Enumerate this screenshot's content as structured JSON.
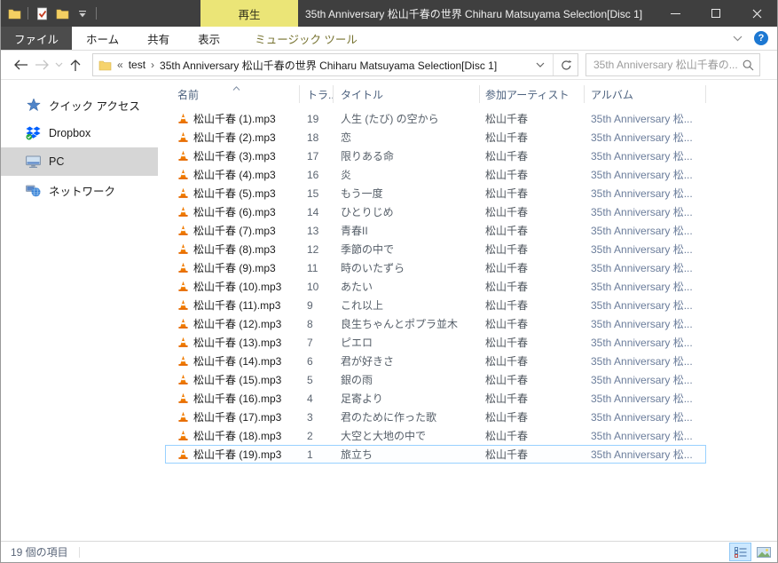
{
  "window": {
    "title": "35th Anniversary 松山千春の世界 Chiharu Matsuyama Selection[Disc 1]",
    "contextual_tab": "再生"
  },
  "ribbon": {
    "tabs": [
      "ファイル",
      "ホーム",
      "共有",
      "表示",
      "ミュージック ツール"
    ]
  },
  "navbar": {
    "breadcrumb_overflow": "«",
    "breadcrumb_separator": "›",
    "segments": [
      "test",
      "35th Anniversary 松山千春の世界 Chiharu Matsuyama Selection[Disc 1]"
    ],
    "search_placeholder": "35th Anniversary 松山千春の..."
  },
  "sidebar": {
    "items": [
      {
        "label": "クイック アクセス",
        "icon": "star-icon"
      },
      {
        "label": "Dropbox",
        "icon": "dropbox-icon"
      },
      {
        "label": "PC",
        "icon": "monitor-icon",
        "selected": true
      },
      {
        "label": "ネットワーク",
        "icon": "network-icon"
      }
    ]
  },
  "filelist": {
    "columns": [
      "名前",
      "トラ...",
      "タイトル",
      "参加アーティスト",
      "アルバム"
    ],
    "sort_column": "名前",
    "sort_direction": "ascending",
    "rows": [
      {
        "name": "松山千春 (1).mp3",
        "track": "19",
        "title": "人生 (たび) の空から",
        "artist": "松山千春",
        "album": "35th Anniversary 松..."
      },
      {
        "name": "松山千春 (2).mp3",
        "track": "18",
        "title": "恋",
        "artist": "松山千春",
        "album": "35th Anniversary 松..."
      },
      {
        "name": "松山千春 (3).mp3",
        "track": "17",
        "title": "限りある命",
        "artist": "松山千春",
        "album": "35th Anniversary 松..."
      },
      {
        "name": "松山千春 (4).mp3",
        "track": "16",
        "title": "炎",
        "artist": "松山千春",
        "album": "35th Anniversary 松..."
      },
      {
        "name": "松山千春 (5).mp3",
        "track": "15",
        "title": "もう一度",
        "artist": "松山千春",
        "album": "35th Anniversary 松..."
      },
      {
        "name": "松山千春 (6).mp3",
        "track": "14",
        "title": "ひとりじめ",
        "artist": "松山千春",
        "album": "35th Anniversary 松..."
      },
      {
        "name": "松山千春 (7).mp3",
        "track": "13",
        "title": "青春II",
        "artist": "松山千春",
        "album": "35th Anniversary 松..."
      },
      {
        "name": "松山千春 (8).mp3",
        "track": "12",
        "title": "季節の中で",
        "artist": "松山千春",
        "album": "35th Anniversary 松..."
      },
      {
        "name": "松山千春 (9).mp3",
        "track": "11",
        "title": "時のいたずら",
        "artist": "松山千春",
        "album": "35th Anniversary 松..."
      },
      {
        "name": "松山千春 (10).mp3",
        "track": "10",
        "title": "あたい",
        "artist": "松山千春",
        "album": "35th Anniversary 松..."
      },
      {
        "name": "松山千春 (11).mp3",
        "track": "9",
        "title": "これ以上",
        "artist": "松山千春",
        "album": "35th Anniversary 松..."
      },
      {
        "name": "松山千春 (12).mp3",
        "track": "8",
        "title": "良生ちゃんとポプラ並木",
        "artist": "松山千春",
        "album": "35th Anniversary 松..."
      },
      {
        "name": "松山千春 (13).mp3",
        "track": "7",
        "title": "ピエロ",
        "artist": "松山千春",
        "album": "35th Anniversary 松..."
      },
      {
        "name": "松山千春 (14).mp3",
        "track": "6",
        "title": "君が好きさ",
        "artist": "松山千春",
        "album": "35th Anniversary 松..."
      },
      {
        "name": "松山千春 (15).mp3",
        "track": "5",
        "title": "銀の雨",
        "artist": "松山千春",
        "album": "35th Anniversary 松..."
      },
      {
        "name": "松山千春 (16).mp3",
        "track": "4",
        "title": "足寄より",
        "artist": "松山千春",
        "album": "35th Anniversary 松..."
      },
      {
        "name": "松山千春 (17).mp3",
        "track": "3",
        "title": "君のために作った歌",
        "artist": "松山千春",
        "album": "35th Anniversary 松..."
      },
      {
        "name": "松山千春 (18).mp3",
        "track": "2",
        "title": "大空と大地の中で",
        "artist": "松山千春",
        "album": "35th Anniversary 松..."
      },
      {
        "name": "松山千春 (19).mp3",
        "track": "1",
        "title": "旅立ち",
        "artist": "松山千春",
        "album": "35th Anniversary 松...",
        "selected": true
      }
    ]
  },
  "statusbar": {
    "items_count": "19 個の項目"
  },
  "colors": {
    "titlebar_bg": "#3f3f3f",
    "contextual_tab_bg": "#ebe577",
    "contextual_tab_text": "#75712e",
    "selection_border": "#99d1ff",
    "view_button_selected_bg": "#cce8ff",
    "sidebar_selected_bg": "#d6d6d6",
    "header_text": "#4c617e",
    "help_icon_bg": "#1d78d2"
  }
}
